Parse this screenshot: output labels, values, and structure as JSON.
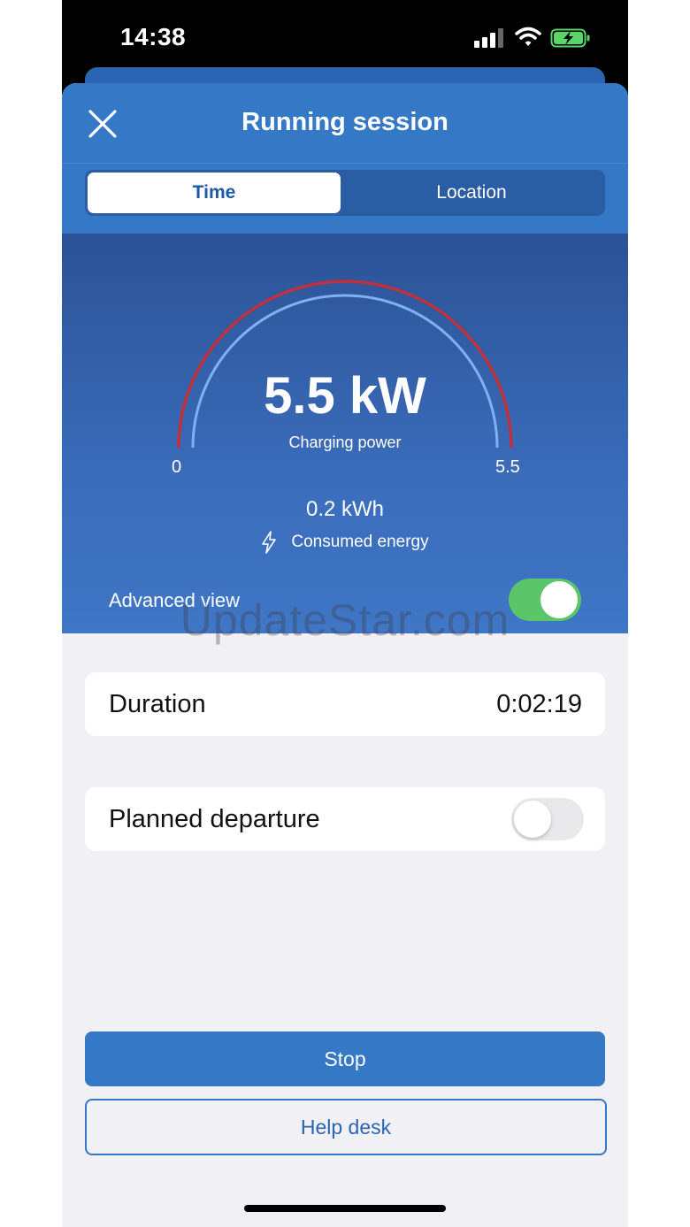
{
  "status_bar": {
    "time": "14:38",
    "icons": [
      "signal-icon",
      "wifi-icon",
      "battery-charging-icon"
    ]
  },
  "header": {
    "title": "Running session",
    "close_icon": "close-icon",
    "tabs": [
      {
        "label": "Time",
        "selected": true
      },
      {
        "label": "Location",
        "selected": false
      }
    ]
  },
  "gauge": {
    "power": "5.5 kW",
    "power_label": "Charging power",
    "min": "0",
    "max": "5.5",
    "level_fraction": 1.0
  },
  "energy": {
    "value": "0.2 kWh",
    "label": "Consumed energy",
    "icon": "lightning-icon"
  },
  "advanced_view": {
    "label": "Advanced view",
    "enabled": true
  },
  "watermark": "UpdateStar.com",
  "duration": {
    "label": "Duration",
    "value": "0:02:19"
  },
  "planned_departure": {
    "label": "Planned departure",
    "enabled": false
  },
  "buttons": {
    "stop": "Stop",
    "help_desk": "Help desk"
  },
  "colors": {
    "primary": "#3478c6",
    "toggle_on": "#5bc56a",
    "gauge_outer": "#c0313b",
    "gauge_inner": "#7fb0f2"
  }
}
